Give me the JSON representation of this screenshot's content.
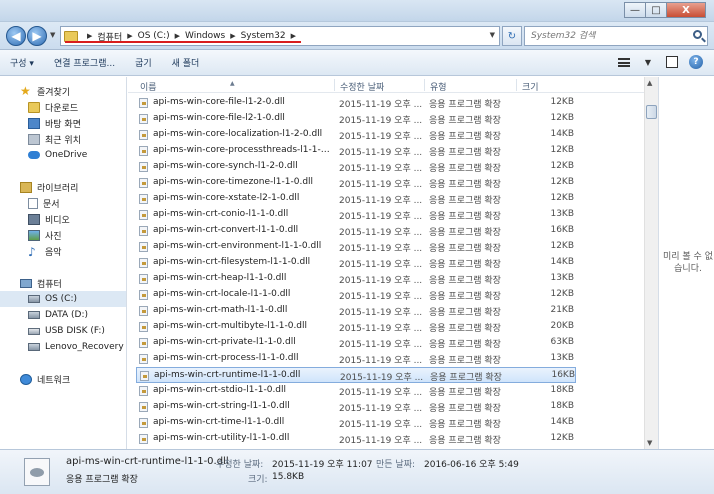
{
  "window": {
    "minimize": "—",
    "maximize": "□",
    "close": "X"
  },
  "nav": {
    "back": "◀",
    "forward": "▶",
    "breadcrumb": [
      "컴퓨터",
      "OS (C:)",
      "Windows",
      "System32"
    ],
    "search_placeholder": "System32 검색",
    "refresh": "↻"
  },
  "toolbar": {
    "organize": "구성 ▾",
    "open_with": "연결 프로그램...",
    "burn": "굽기",
    "new_folder": "새 폴더"
  },
  "sidebar": {
    "favorites": {
      "header": "즐겨찾기",
      "items": [
        "다운로드",
        "바탕 화면",
        "최근 위치",
        "OneDrive"
      ]
    },
    "libraries": {
      "header": "라이브러리",
      "items": [
        "문서",
        "비디오",
        "사진",
        "음악"
      ]
    },
    "computer": {
      "header": "컴퓨터",
      "items": [
        "OS (C:)",
        "DATA (D:)",
        "USB DISK (F:)",
        "Lenovo_Recovery (C"
      ]
    },
    "network": {
      "header": "네트워크"
    }
  },
  "columns": {
    "name": "이름",
    "date": "수정한 날짜",
    "type": "유형",
    "size": "크기"
  },
  "files": [
    {
      "name": "api-ms-win-core-file-l1-2-0.dll",
      "date": "2015-11-19 오후 ...",
      "type": "응용 프로그램 확장",
      "size": "12KB"
    },
    {
      "name": "api-ms-win-core-file-l2-1-0.dll",
      "date": "2015-11-19 오후 ...",
      "type": "응용 프로그램 확장",
      "size": "12KB"
    },
    {
      "name": "api-ms-win-core-localization-l1-2-0.dll",
      "date": "2015-11-19 오후 ...",
      "type": "응용 프로그램 확장",
      "size": "14KB"
    },
    {
      "name": "api-ms-win-core-processthreads-l1-1-1...",
      "date": "2015-11-19 오후 ...",
      "type": "응용 프로그램 확장",
      "size": "12KB"
    },
    {
      "name": "api-ms-win-core-synch-l1-2-0.dll",
      "date": "2015-11-19 오후 ...",
      "type": "응용 프로그램 확장",
      "size": "12KB"
    },
    {
      "name": "api-ms-win-core-timezone-l1-1-0.dll",
      "date": "2015-11-19 오후 ...",
      "type": "응용 프로그램 확장",
      "size": "12KB"
    },
    {
      "name": "api-ms-win-core-xstate-l2-1-0.dll",
      "date": "2015-11-19 오후 ...",
      "type": "응용 프로그램 확장",
      "size": "12KB"
    },
    {
      "name": "api-ms-win-crt-conio-l1-1-0.dll",
      "date": "2015-11-19 오후 ...",
      "type": "응용 프로그램 확장",
      "size": "13KB"
    },
    {
      "name": "api-ms-win-crt-convert-l1-1-0.dll",
      "date": "2015-11-19 오후 ...",
      "type": "응용 프로그램 확장",
      "size": "16KB"
    },
    {
      "name": "api-ms-win-crt-environment-l1-1-0.dll",
      "date": "2015-11-19 오후 ...",
      "type": "응용 프로그램 확장",
      "size": "12KB"
    },
    {
      "name": "api-ms-win-crt-filesystem-l1-1-0.dll",
      "date": "2015-11-19 오후 ...",
      "type": "응용 프로그램 확장",
      "size": "14KB"
    },
    {
      "name": "api-ms-win-crt-heap-l1-1-0.dll",
      "date": "2015-11-19 오후 ...",
      "type": "응용 프로그램 확장",
      "size": "13KB"
    },
    {
      "name": "api-ms-win-crt-locale-l1-1-0.dll",
      "date": "2015-11-19 오후 ...",
      "type": "응용 프로그램 확장",
      "size": "12KB"
    },
    {
      "name": "api-ms-win-crt-math-l1-1-0.dll",
      "date": "2015-11-19 오후 ...",
      "type": "응용 프로그램 확장",
      "size": "21KB"
    },
    {
      "name": "api-ms-win-crt-multibyte-l1-1-0.dll",
      "date": "2015-11-19 오후 ...",
      "type": "응용 프로그램 확장",
      "size": "20KB"
    },
    {
      "name": "api-ms-win-crt-private-l1-1-0.dll",
      "date": "2015-11-19 오후 ...",
      "type": "응용 프로그램 확장",
      "size": "63KB"
    },
    {
      "name": "api-ms-win-crt-process-l1-1-0.dll",
      "date": "2015-11-19 오후 ...",
      "type": "응용 프로그램 확장",
      "size": "13KB"
    },
    {
      "name": "api-ms-win-crt-runtime-l1-1-0.dll",
      "date": "2015-11-19 오후 ...",
      "type": "응용 프로그램 확장",
      "size": "16KB"
    },
    {
      "name": "api-ms-win-crt-stdio-l1-1-0.dll",
      "date": "2015-11-19 오후 ...",
      "type": "응용 프로그램 확장",
      "size": "18KB"
    },
    {
      "name": "api-ms-win-crt-string-l1-1-0.dll",
      "date": "2015-11-19 오후 ...",
      "type": "응용 프로그램 확장",
      "size": "18KB"
    },
    {
      "name": "api-ms-win-crt-time-l1-1-0.dll",
      "date": "2015-11-19 오후 ...",
      "type": "응용 프로그램 확장",
      "size": "14KB"
    },
    {
      "name": "api-ms-win-crt-utility-l1-1-0.dll",
      "date": "2015-11-19 오후 ...",
      "type": "응용 프로그램 확장",
      "size": "12KB"
    }
  ],
  "selected_index": 17,
  "preview": {
    "text": "미리 볼 수 없습니다."
  },
  "details": {
    "filename": "api-ms-win-crt-runtime-l1-1-0.dll",
    "filetype": "응용 프로그램 확장",
    "modified_label": "수정한 날짜:",
    "modified_value": "2015-11-19 오후 11:07",
    "created_label": "만든 날짜:",
    "created_value": "2016-06-16 오후 5:49",
    "size_label": "크기:",
    "size_value": "15.8KB"
  },
  "colors": {
    "accent": "#2f6db4",
    "highlight_underline": "#d81e1e",
    "selection": "#cfe4fb"
  },
  "icons": {
    "file": "dll-file-icon",
    "search": "search-icon",
    "folder": "folder-icon"
  }
}
